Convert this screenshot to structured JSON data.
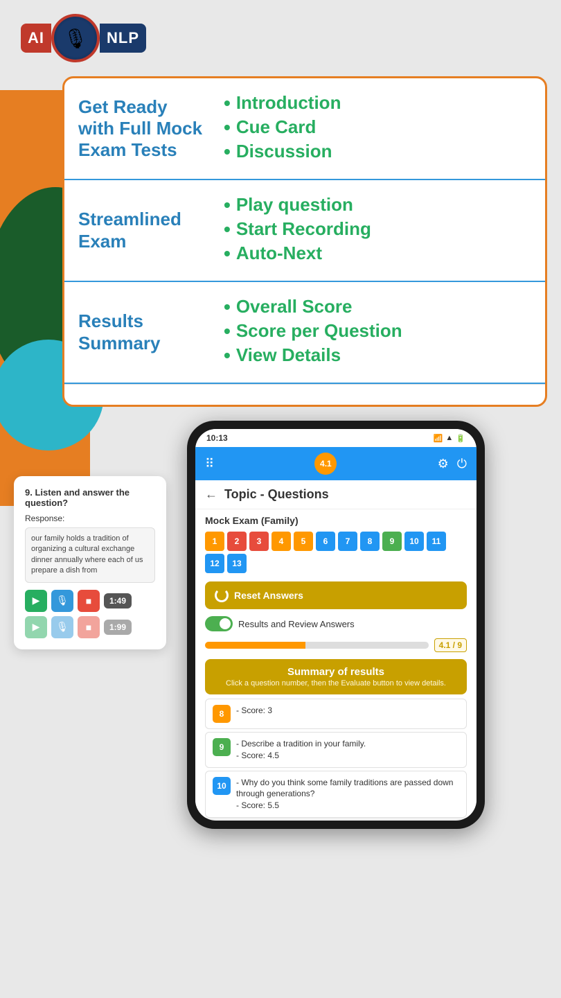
{
  "header": {
    "logo_ai": "AI",
    "logo_nlp": "NLP"
  },
  "features": {
    "card1": {
      "title": "Get Ready with Full Mock Exam Tests",
      "items": [
        "Introduction",
        "Cue Card",
        "Discussion"
      ]
    },
    "card2": {
      "title": "Streamlined Exam",
      "items": [
        "Play question",
        "Start Recording",
        "Auto-Next"
      ]
    },
    "card3": {
      "title": "Results Summary",
      "items": [
        "Overall Score",
        "Score per Question",
        "View Details"
      ]
    }
  },
  "paper_card": {
    "question": "9. Listen and answer the question?",
    "response_label": "Response:",
    "response_text": "our family holds a tradition of organizing a cultural exchange dinner annually where each of us prepare a dish from",
    "timer": "1:49",
    "timer2": "1:99"
  },
  "phone": {
    "status_time": "10:13",
    "nav_score": "4.1",
    "topic_title": "Topic - Questions",
    "mock_exam_label": "Mock Exam (Family)",
    "question_numbers": [
      {
        "num": "1",
        "color": "orange"
      },
      {
        "num": "2",
        "color": "red"
      },
      {
        "num": "3",
        "color": "red"
      },
      {
        "num": "4",
        "color": "orange"
      },
      {
        "num": "5",
        "color": "orange"
      },
      {
        "num": "6",
        "color": "blue"
      },
      {
        "num": "7",
        "color": "blue"
      },
      {
        "num": "8",
        "color": "blue"
      },
      {
        "num": "9",
        "color": "green"
      },
      {
        "num": "10",
        "color": "blue"
      },
      {
        "num": "11",
        "color": "blue"
      },
      {
        "num": "12",
        "color": "blue"
      },
      {
        "num": "13",
        "color": "blue"
      }
    ],
    "reset_btn": "Reset Answers",
    "results_label": "Results and Review Answers",
    "score_fraction": "4.1 / 9",
    "summary_title": "Summary of results",
    "summary_subtitle": "Click a question number, then the Evaluate button to view details.",
    "result_items": [
      {
        "num": "8",
        "color": "orange",
        "text": "- Score: 3"
      },
      {
        "num": "9",
        "color": "green",
        "text": "- Describe a tradition in your family.\n- Score: 4.5"
      },
      {
        "num": "10",
        "color": "blue",
        "text": "- Why do you think some family traditions are passed down through generations?\n- Score: 5.5"
      }
    ]
  }
}
